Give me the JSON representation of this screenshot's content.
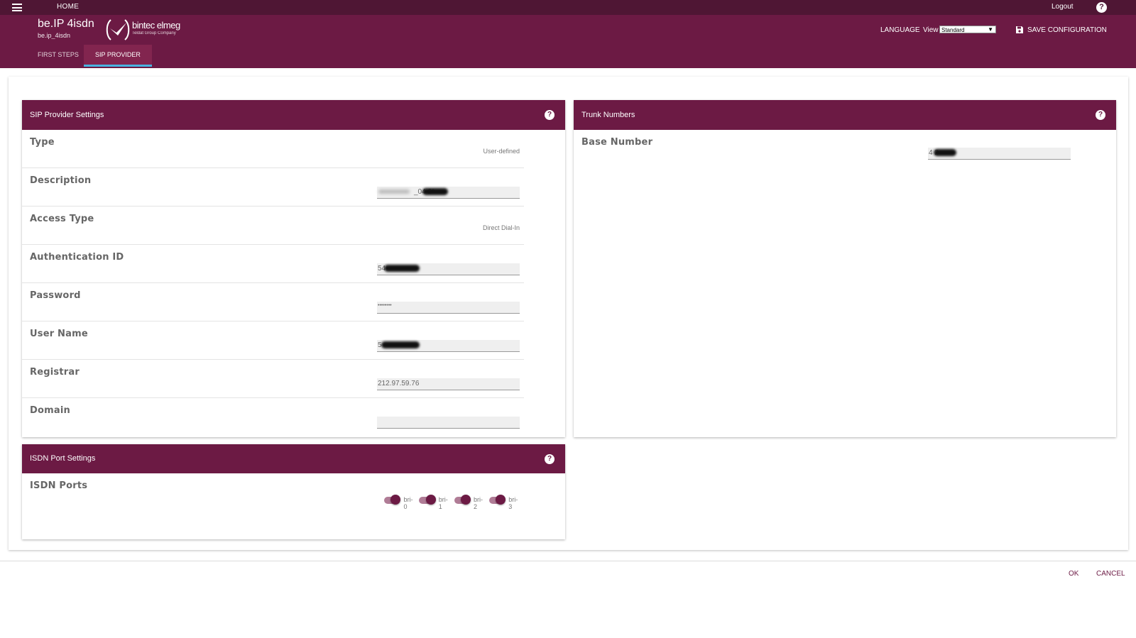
{
  "topbar": {
    "menu_icon": "hamburger-menu-icon",
    "home_label": "HOME",
    "logout_label": "Logout",
    "help_icon": "help-icon",
    "help_glyph": "?"
  },
  "header": {
    "device_name": "be.IP 4isdn",
    "device_sub": "be.ip_4isdn",
    "logo_text": "bintec elmeg",
    "logo_sub": "Teldat Group Company",
    "language_label": "LANGUAGE",
    "view_label": "View",
    "view_selected": "Standard",
    "save_label": "SAVE CONFIGURATION",
    "tabs": [
      {
        "label": "FIRST STEPS",
        "active": false
      },
      {
        "label": "SIP PROVIDER",
        "active": true
      }
    ]
  },
  "sip_settings": {
    "title": "SIP Provider Settings",
    "rows": [
      {
        "label": "Type",
        "value": "User-defined"
      },
      {
        "label": "Description",
        "value": "_04 2*"
      },
      {
        "label": "Access Type",
        "value": "Direct Dial-In"
      },
      {
        "label": "Authentication ID",
        "value": "54"
      },
      {
        "label": "Password",
        "value": "••••••••"
      },
      {
        "label": "User Name",
        "value": "5"
      },
      {
        "label": "Registrar",
        "value": "212.97.59.76"
      },
      {
        "label": "Domain",
        "value": ""
      }
    ]
  },
  "trunk": {
    "title": "Trunk Numbers",
    "base_label": "Base Number",
    "base_value": "4 2"
  },
  "isdn": {
    "title": "ISDN Port Settings",
    "ports_label": "ISDN Ports",
    "ports": [
      {
        "label": "bri-0",
        "on": true
      },
      {
        "label": "bri-1",
        "on": true
      },
      {
        "label": "bri-2",
        "on": true
      },
      {
        "label": "bri-3",
        "on": true
      }
    ]
  },
  "footer": {
    "ok_label": "OK",
    "cancel_label": "CANCEL"
  },
  "colors": {
    "topbar": "#4f1634",
    "header": "#6c1a44",
    "tab_underline": "#49b3e0"
  }
}
